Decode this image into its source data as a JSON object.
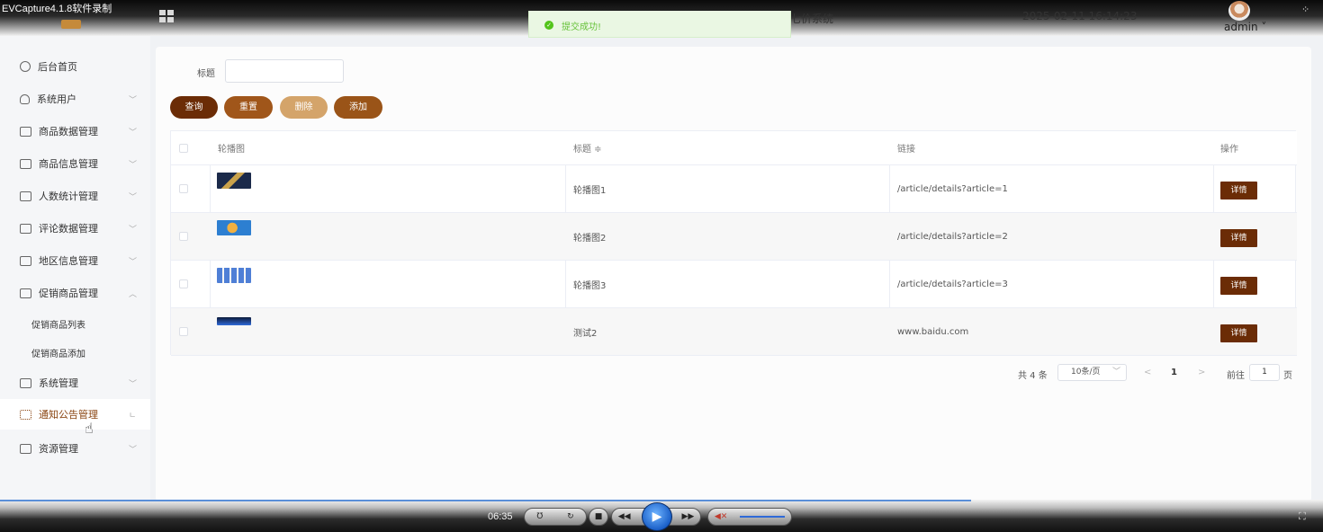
{
  "recorder": {
    "title": "EVCapture4.1.8软件录制",
    "time": "06:35",
    "progress_fraction": 0.734
  },
  "header": {
    "system_title_fragment": "七价系统",
    "datetime": "2025-02-11 16:14:23",
    "user": "admin ˅"
  },
  "toast": {
    "message": "提交成功!"
  },
  "sidebar": {
    "items": [
      {
        "label": "后台首页",
        "icon": "clock-icon"
      },
      {
        "label": "系统用户",
        "icon": "user-icon",
        "chevron": "﹀"
      },
      {
        "label": "商品数据管理",
        "icon": "list-icon",
        "chevron": "﹀"
      },
      {
        "label": "商品信息管理",
        "icon": "list-icon",
        "chevron": "﹀"
      },
      {
        "label": "人数统计管理",
        "icon": "list-icon",
        "chevron": "﹀"
      },
      {
        "label": "评论数据管理",
        "icon": "list-icon",
        "chevron": "﹀"
      },
      {
        "label": "地区信息管理",
        "icon": "list-icon",
        "chevron": "﹀"
      },
      {
        "label": "促销商品管理",
        "icon": "list-icon",
        "chevron": "︿"
      },
      {
        "label": "促销商品列表"
      },
      {
        "label": "促销商品添加"
      },
      {
        "label": "系统管理",
        "icon": "folder-icon",
        "chevron": "﹀"
      },
      {
        "label": "通知公告管理",
        "icon": "loading-icon",
        "chevron": "ㄴ"
      },
      {
        "label": "资源管理",
        "icon": "box-icon",
        "chevron": "﹀"
      }
    ]
  },
  "search": {
    "label": "标题",
    "value": ""
  },
  "buttons": {
    "query": "查询",
    "reset": "重置",
    "delete": "删除",
    "add": "添加"
  },
  "table": {
    "headers": {
      "image": "轮播图",
      "title": "标题 ≑",
      "link": "链接",
      "action": "操作"
    },
    "rows": [
      {
        "title": "轮播图1",
        "link": "/article/details?article=1",
        "action": "详情",
        "thumb_colors": [
          "#1b2a4a",
          "#c9a24b"
        ]
      },
      {
        "title": "轮播图2",
        "link": "/article/details?article=2",
        "action": "详情",
        "thumb_colors": [
          "#2d7fd1",
          "#f0b042"
        ]
      },
      {
        "title": "轮播图3",
        "link": "/article/details?article=3",
        "action": "详情",
        "thumb_colors": [
          "#4f7fd6",
          "#f5f5f5"
        ]
      },
      {
        "title": "测试2",
        "link": "www.baidu.com",
        "action": "详情",
        "thumb_colors": [
          "#0c1a3a",
          "#2f6ad8"
        ]
      }
    ]
  },
  "pagination": {
    "total": "共 4 条",
    "page_size": "10条/页",
    "prev": "<",
    "current": "1",
    "next": ">",
    "goto_label": "前往",
    "goto_value": "1",
    "goto_suffix": "页"
  },
  "colors": {
    "primary": "#6b2c06",
    "accent": "#a0561a",
    "light_accent": "#d4a46a",
    "success": "#67c23a"
  }
}
